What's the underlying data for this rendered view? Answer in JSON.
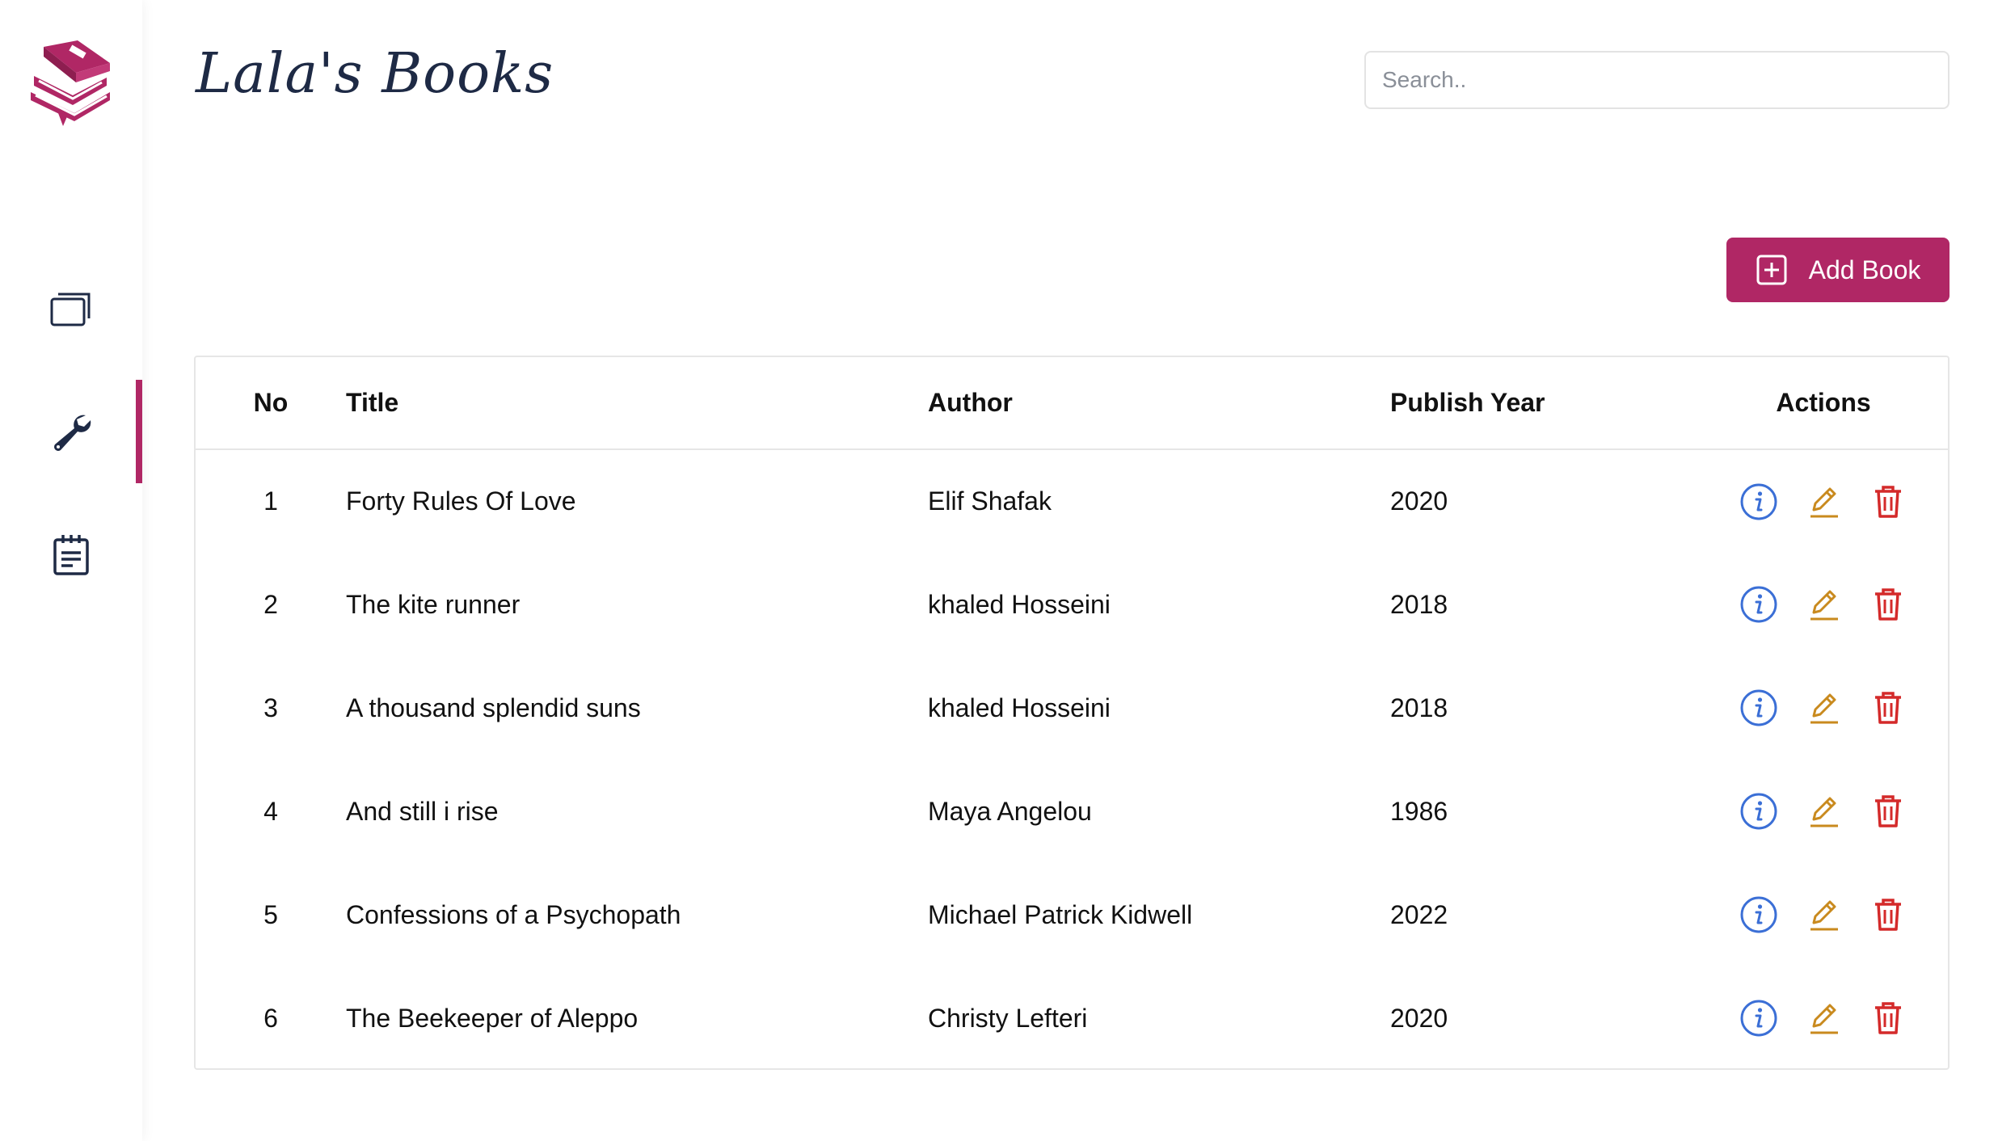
{
  "app": {
    "title": "Lala's Books",
    "accent": "#b02765"
  },
  "search": {
    "placeholder": "Search.."
  },
  "sidebar": {
    "items": [
      {
        "icon": "cards-icon",
        "active": false
      },
      {
        "icon": "wrench-icon",
        "active": true
      },
      {
        "icon": "clipboard-icon",
        "active": false
      }
    ]
  },
  "toolbar": {
    "add_label": "Add Book"
  },
  "table": {
    "headers": {
      "no": "No",
      "title": "Title",
      "author": "Author",
      "year": "Publish Year",
      "actions": "Actions"
    },
    "rows": [
      {
        "no": "1",
        "title": "Forty Rules Of Love",
        "author": "Elif Shafak",
        "year": "2020"
      },
      {
        "no": "2",
        "title": "The kite runner",
        "author": "khaled Hosseini",
        "year": "2018"
      },
      {
        "no": "3",
        "title": "A thousand splendid suns",
        "author": "khaled Hosseini",
        "year": "2018"
      },
      {
        "no": "4",
        "title": "And still i rise",
        "author": "Maya Angelou",
        "year": "1986"
      },
      {
        "no": "5",
        "title": "Confessions of a Psychopath",
        "author": "Michael Patrick Kidwell",
        "year": "2022"
      },
      {
        "no": "6",
        "title": "The Beekeeper of Aleppo",
        "author": "Christy Lefteri",
        "year": "2020"
      }
    ]
  },
  "colors": {
    "info": "#3b6fd6",
    "edit": "#c98a1e",
    "delete": "#d42a2a"
  }
}
